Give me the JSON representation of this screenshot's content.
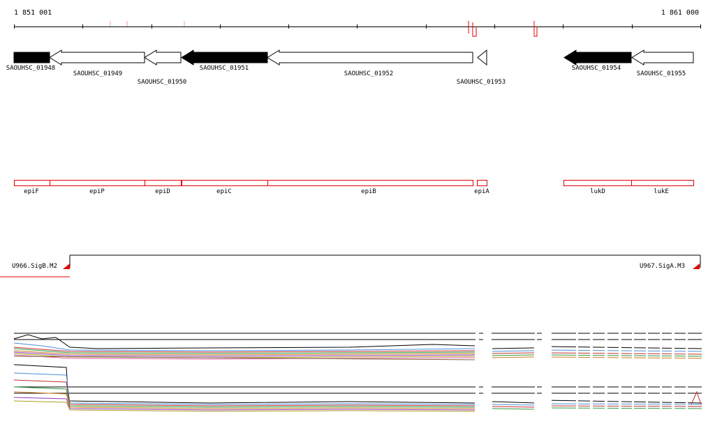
{
  "ruler": {
    "start_label": "1 851 001",
    "end_label": "1 861 000"
  },
  "genes": [
    {
      "id": "SAOUHSC_01948",
      "filled": true
    },
    {
      "id": "SAOUHSC_01949",
      "filled": false
    },
    {
      "id": "SAOUHSC_01950",
      "filled": false
    },
    {
      "id": "SAOUHSC_01951",
      "filled": true
    },
    {
      "id": "SAOUHSC_01952",
      "filled": false
    },
    {
      "id": "SAOUHSC_01953",
      "filled": false
    },
    {
      "id": "SAOUHSC_01954",
      "filled": true
    },
    {
      "id": "SAOUHSC_01955",
      "filled": false
    }
  ],
  "annotations": [
    "epiF",
    "epiP",
    "epiD",
    "epiC",
    "epiB",
    "epiA",
    "lukD",
    "lukE"
  ],
  "promoters": {
    "left": "U966.SigB.M2",
    "right": "U967.SigA.M3"
  },
  "colors": {
    "annotation_border": "#e00000",
    "promoter_marker": "#e00000",
    "gene_fill": "#000000"
  }
}
